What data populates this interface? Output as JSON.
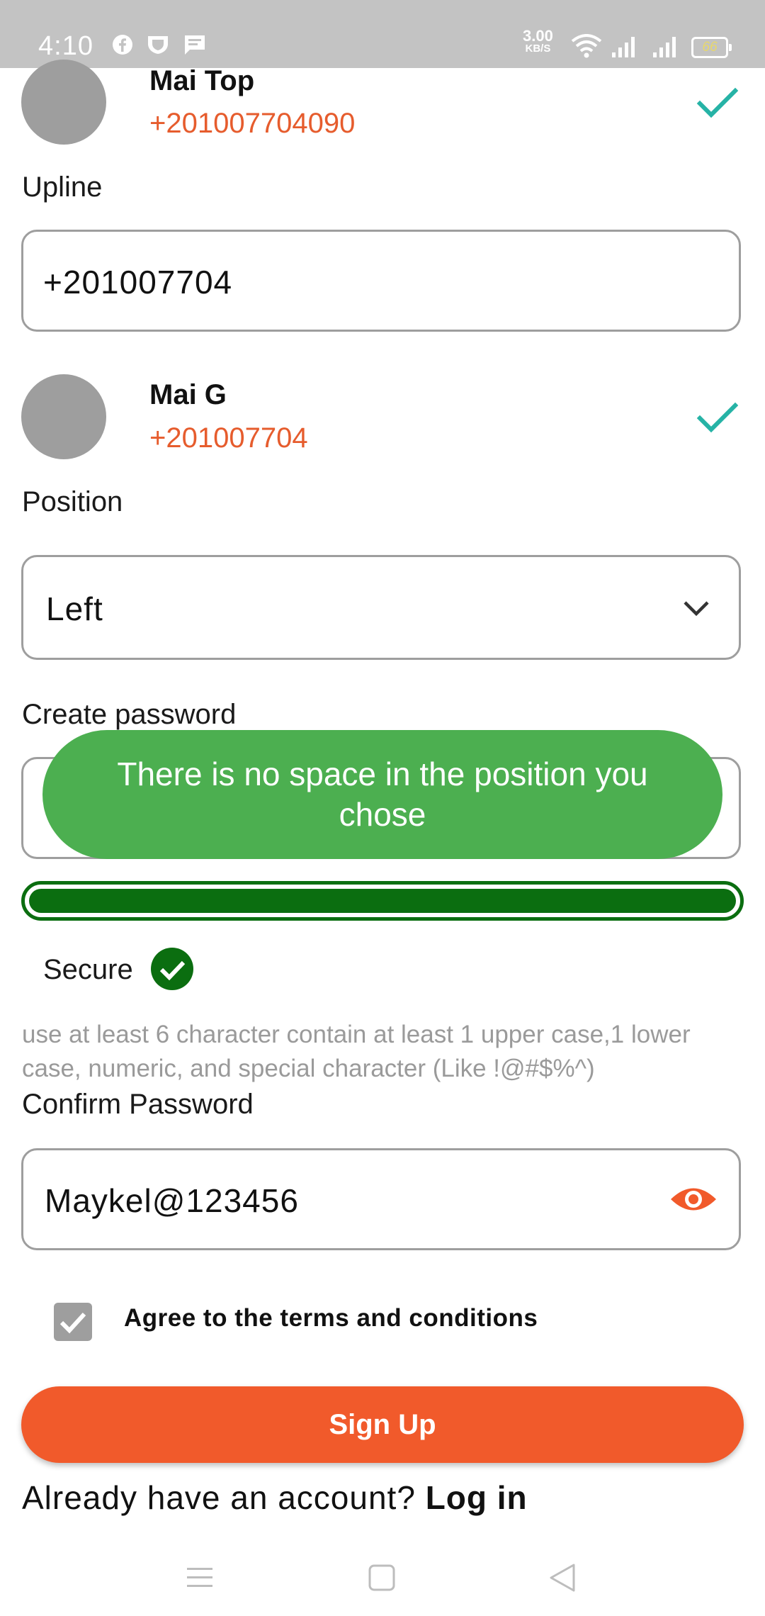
{
  "status_bar": {
    "time": "4:10",
    "net_speed_value": "3.00",
    "net_speed_unit": "KB/S",
    "battery": "66"
  },
  "top_user": {
    "name": "Mai Top",
    "phone": "+201007704090"
  },
  "upline": {
    "label": "Upline",
    "value": "+201007704"
  },
  "upline_user": {
    "name": "Mai G",
    "phone": "+201007704"
  },
  "position": {
    "label": "Position",
    "selected": "Left"
  },
  "create_password": {
    "label": "Create password"
  },
  "toast": {
    "message": "There is no space in the position you chose"
  },
  "strength": {
    "level": 1.0,
    "status": "Secure"
  },
  "password_hint": "use at least 6 character contain at least 1 upper case,1 lower case, numeric, and special character (Like !@#$%^)",
  "confirm_password": {
    "label": "Confirm Password",
    "value": "Maykel@123456"
  },
  "terms": {
    "label": "Agree to the terms and conditions",
    "checked": true
  },
  "signup_button": "Sign Up",
  "login_prompt": {
    "question": "Already have an account? ",
    "link": "Log in"
  },
  "colors": {
    "accent": "#f15a2b",
    "phone": "#e65c2d",
    "check": "#26b3a6",
    "toast": "#4caf50",
    "strength": "#0b6e10"
  }
}
